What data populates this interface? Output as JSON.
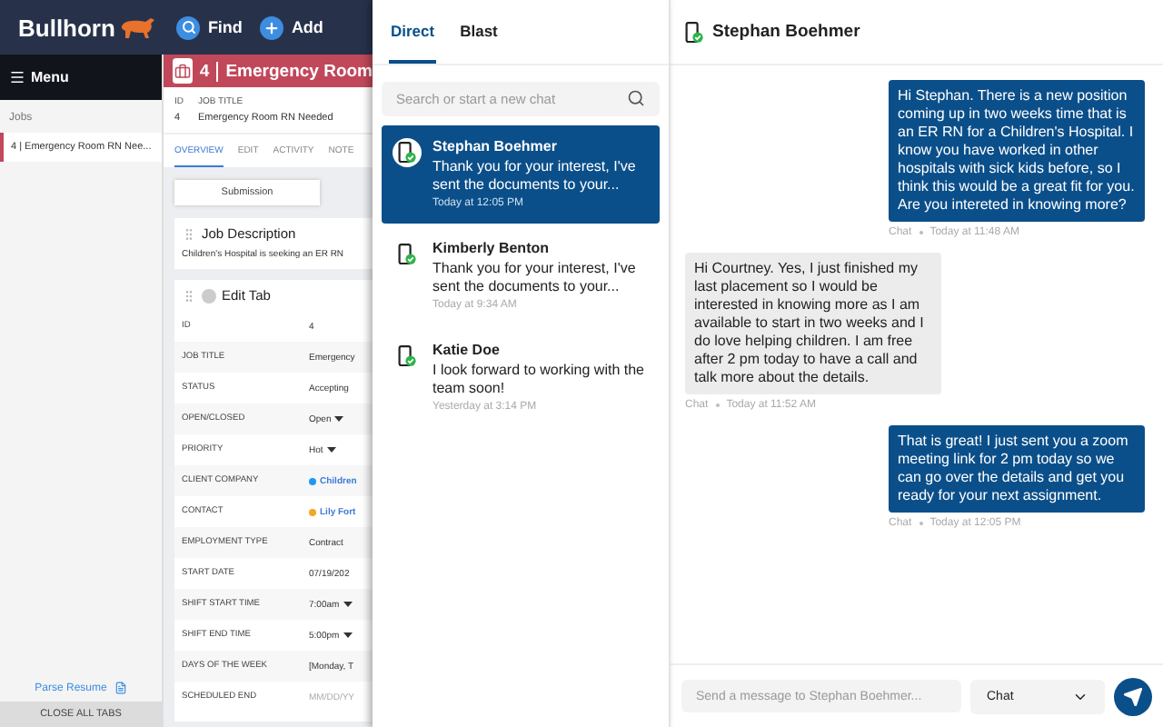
{
  "app": {
    "logo": "Bullhorn",
    "nav": [
      {
        "label": "Find",
        "kind": "search"
      },
      {
        "label": "Add",
        "kind": "add"
      }
    ]
  },
  "sidebar": {
    "title": "Menu",
    "section": "Jobs",
    "items": [
      {
        "label": "4 | Emergency Room RN Nee...",
        "selected": true
      }
    ],
    "parse_resume": "Parse Resume",
    "close_all": "CLOSE ALL TABS"
  },
  "record": {
    "id": "4",
    "title": "Emergency Room",
    "summary": [
      {
        "label": "ID",
        "value": "4"
      },
      {
        "label": "JOB TITLE",
        "value": "Emergency Room RN Needed"
      }
    ],
    "tabs": [
      {
        "label": "OVERVIEW",
        "selected": true
      },
      {
        "label": "EDIT",
        "selected": false
      },
      {
        "label": "ACTIVITY",
        "selected": false
      },
      {
        "label": "NOTE",
        "selected": false
      }
    ],
    "actions": [
      "Submission"
    ],
    "job_description": {
      "title": "Job Description",
      "text": "Children's Hospital is seeking an ER RN"
    },
    "edit_tab": {
      "title": "Edit Tab",
      "fields": [
        {
          "label": "ID",
          "value": "4",
          "kind": "text"
        },
        {
          "label": "JOB TITLE",
          "value": "Emergency",
          "kind": "text"
        },
        {
          "label": "STATUS",
          "value": "Accepting",
          "kind": "text"
        },
        {
          "label": "OPEN/CLOSED",
          "value": "Open",
          "kind": "select"
        },
        {
          "label": "PRIORITY",
          "value": "Hot",
          "kind": "select"
        },
        {
          "label": "CLIENT COMPANY",
          "value": "Children",
          "kind": "link",
          "color": "#2196f3"
        },
        {
          "label": "CONTACT",
          "value": "Lily Fort",
          "kind": "link",
          "color": "#f5a623"
        },
        {
          "label": "EMPLOYMENT TYPE",
          "value": "Contract",
          "kind": "text"
        },
        {
          "label": "START DATE",
          "value": "07/19/202",
          "kind": "text"
        },
        {
          "label": "SHIFT START TIME",
          "value": "7:00am",
          "kind": "select"
        },
        {
          "label": "SHIFT END TIME",
          "value": "5:00pm",
          "kind": "select"
        },
        {
          "label": "DAYS OF THE WEEK",
          "value": "[Monday, T",
          "kind": "text"
        },
        {
          "label": "SCHEDULED END",
          "value": "MM/DD/YY",
          "kind": "placeholder"
        }
      ]
    }
  },
  "chat": {
    "tabs": [
      {
        "label": "Direct",
        "selected": true
      },
      {
        "label": "Blast",
        "selected": false
      }
    ],
    "search": {
      "placeholder": "Search or start a new chat"
    },
    "conversations": [
      {
        "name": "Stephan Boehmer",
        "preview": "Thank you for your interest, I've sent the documents to your...",
        "time": "Today at 12:05 PM",
        "selected": true
      },
      {
        "name": "Kimberly Benton",
        "preview": "Thank you for your interest, I've sent the documents to your...",
        "time": "Today at 9:34 AM",
        "selected": false
      },
      {
        "name": "Katie Doe",
        "preview": "I look forward to working with the team soon!",
        "time": "Yesterday at 3:14 PM",
        "selected": false
      }
    ],
    "thread": {
      "name": "Stephan Boehmer",
      "messages": [
        {
          "kind": "outgoing",
          "text": "Hi Stephan. There is a new position coming up in two weeks time that is an ER RN for a Children's Hospital. I know you have worked in other hospitals with sick kids before, so I think this would be a great fit for you. Are you intereted in knowing more?",
          "channel": "Chat",
          "time": "Today at 11:48 AM"
        },
        {
          "kind": "incoming",
          "text": "Hi Courtney. Yes, I just finished my last placement so I would be interested in knowing more as I am available to start in two weeks and I do love helping children. I am free after 2 pm today to have a call and talk more about the details.",
          "channel": "Chat",
          "time": "Today at 11:52 AM"
        },
        {
          "kind": "outgoing",
          "text": "That is great! I just sent you a zoom meeting link for 2 pm today so we can go over the details and get you ready for your next assignment.",
          "channel": "Chat",
          "time": "Today at 12:05 PM"
        }
      ]
    },
    "composer": {
      "placeholder": "Send a message to Stephan Boehmer...",
      "channel": "Chat"
    }
  }
}
